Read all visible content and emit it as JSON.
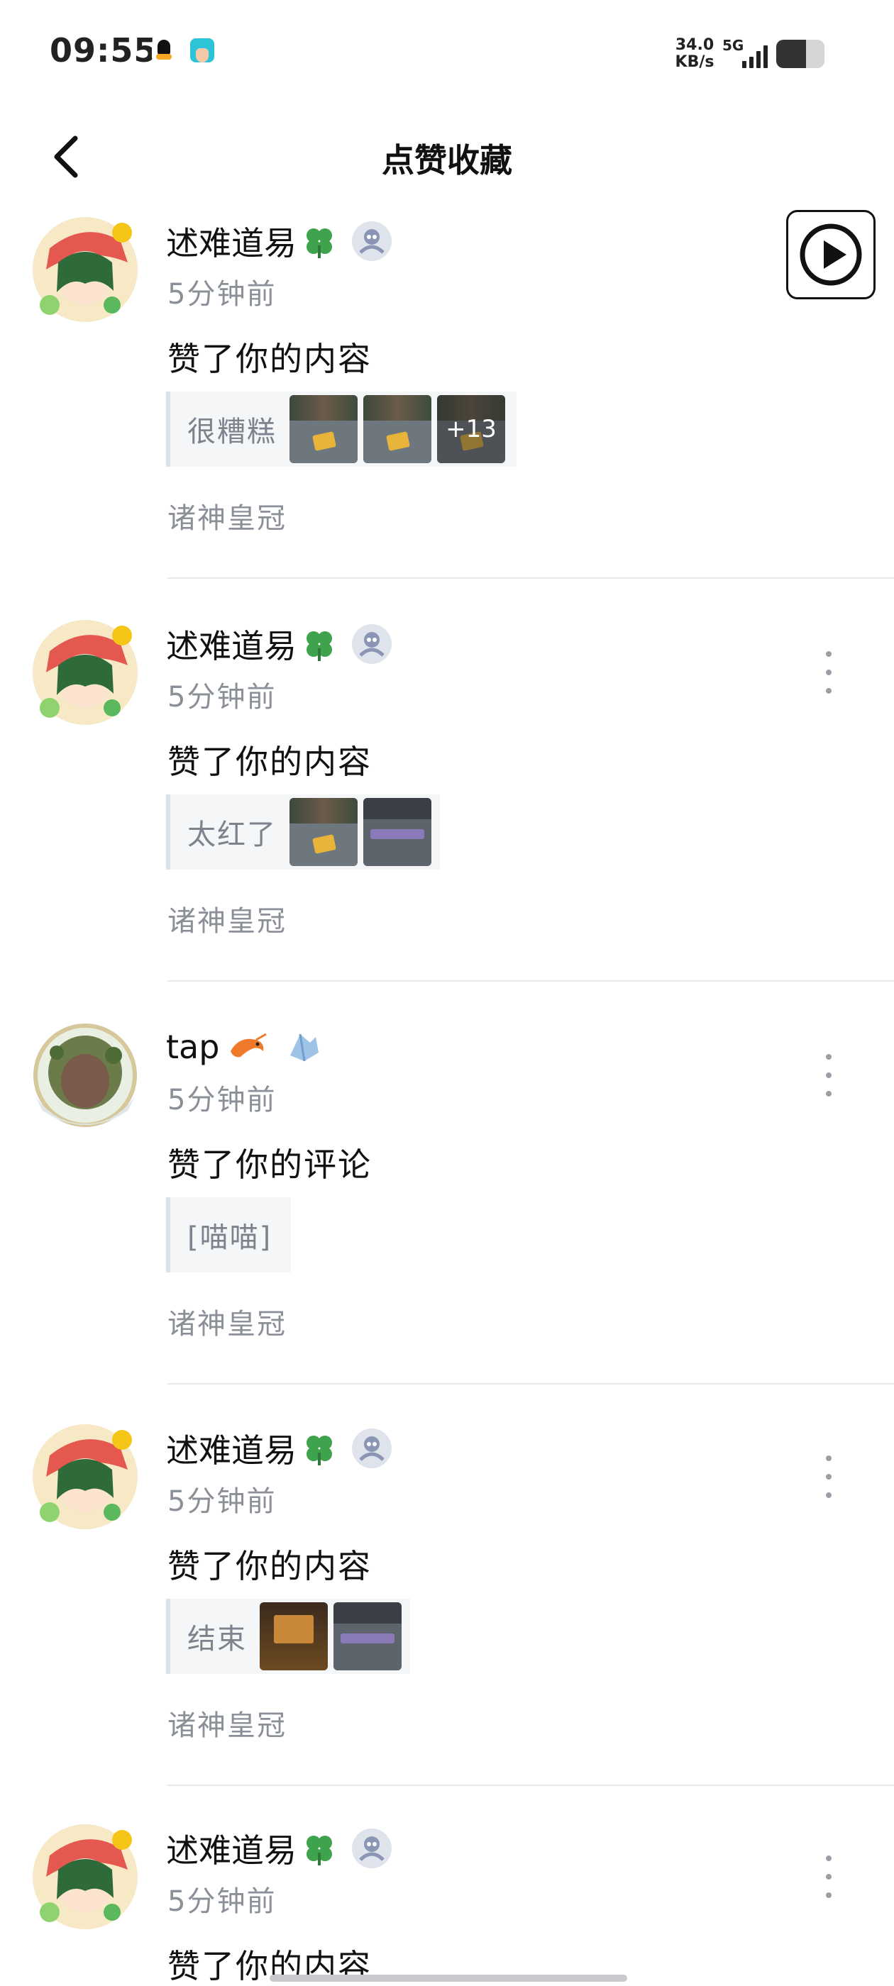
{
  "status_bar": {
    "time": "09:55",
    "net_speed_value": "34.0",
    "net_speed_unit": "KB/s",
    "network_type": "5G",
    "battery_level": 0.62
  },
  "header": {
    "title": "点赞收藏"
  },
  "notifications": [
    {
      "user": "述难道易",
      "name_emoji": "clover",
      "time_ago": "5分钟前",
      "action": "赞了你的内容",
      "quote": "很糟糕",
      "thumbnails": [
        "game-screenshot",
        "game-screenshot",
        "game-screenshot"
      ],
      "more_count": "+13",
      "source": "诸神皇冠"
    },
    {
      "user": "述难道易",
      "name_emoji": "clover",
      "time_ago": "5分钟前",
      "action": "赞了你的内容",
      "quote": "太红了",
      "thumbnails": [
        "game-screenshot",
        "game-screenshot"
      ],
      "source": "诸神皇冠"
    },
    {
      "user": "tap",
      "name_emoji": "shrimp",
      "time_ago": "5分钟前",
      "action": "赞了你的评论",
      "quote": "[喵喵]",
      "thumbnails": [],
      "source": "诸神皇冠"
    },
    {
      "user": "述难道易",
      "name_emoji": "clover",
      "time_ago": "5分钟前",
      "action": "赞了你的内容",
      "quote": "结束",
      "thumbnails": [
        "game-screenshot-dark",
        "game-screenshot-grey"
      ],
      "source": "诸神皇冠"
    },
    {
      "user": "述难道易",
      "name_emoji": "clover",
      "time_ago": "5分钟前",
      "action": "赞了你的内容"
    }
  ],
  "icons": {
    "back": "chevron-left-icon",
    "float": "play-circle-icon",
    "more": "more-vertical-icon"
  }
}
